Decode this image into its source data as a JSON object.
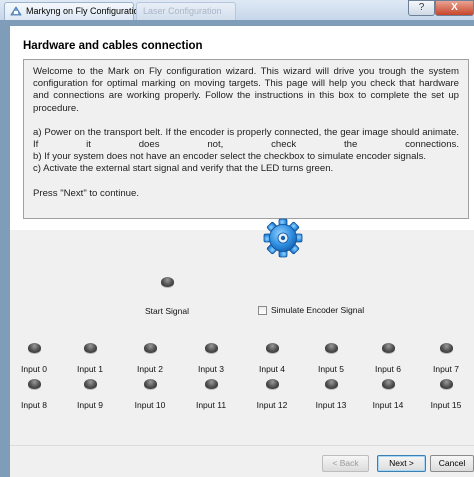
{
  "window": {
    "title": "Markyng on Fly Configuration",
    "inactive_tab": "Laser Configuration",
    "help_glyph": "?",
    "close_glyph": "X"
  },
  "page": {
    "title": "Hardware and cables connection",
    "intro": "Welcome to the Mark on Fly configuration wizard. This wizard will drive you trough the system configuration for optimal marking on moving targets. This page will help you check that hardware and connections are working properly. Follow the instructions in this box to complete the set up procedure.",
    "step_a": "a) Power on the transport belt. If the encoder is properly connected, the gear image should animate. If it does not, check the connections.",
    "step_b": "b) If your system does not have an encoder select the checkbox to simulate encoder signals.",
    "step_c": "c) Activate the external start signal and verify that the LED turns green.",
    "footer": "Press \"Next\" to continue."
  },
  "start_signal": {
    "label": "Start Signal",
    "state": "off"
  },
  "simulate_encoder": {
    "label": "Simulate Encoder Signal",
    "checked": false
  },
  "inputs": [
    {
      "label": "Input 0",
      "state": "off"
    },
    {
      "label": "Input 1",
      "state": "off"
    },
    {
      "label": "Input 2",
      "state": "off"
    },
    {
      "label": "Input 3",
      "state": "off"
    },
    {
      "label": "Input 4",
      "state": "off"
    },
    {
      "label": "Input 5",
      "state": "off"
    },
    {
      "label": "Input 6",
      "state": "off"
    },
    {
      "label": "Input 7",
      "state": "off"
    },
    {
      "label": "Input 8",
      "state": "off"
    },
    {
      "label": "Input 9",
      "state": "off"
    },
    {
      "label": "Input 10",
      "state": "off"
    },
    {
      "label": "Input 11",
      "state": "off"
    },
    {
      "label": "Input 12",
      "state": "off"
    },
    {
      "label": "Input 13",
      "state": "off"
    },
    {
      "label": "Input 14",
      "state": "off"
    },
    {
      "label": "Input 15",
      "state": "off"
    }
  ],
  "buttons": {
    "back": "< Back",
    "next": "Next >",
    "cancel": "Cancel"
  },
  "icons": {
    "app": "wizard-app-icon",
    "gear": "encoder-gear-icon",
    "led": "led-indicator-icon"
  },
  "colors": {
    "gear_fill": "#2f8fe0",
    "led_off": "#4d4d4d",
    "close_button": "#c7452a"
  }
}
